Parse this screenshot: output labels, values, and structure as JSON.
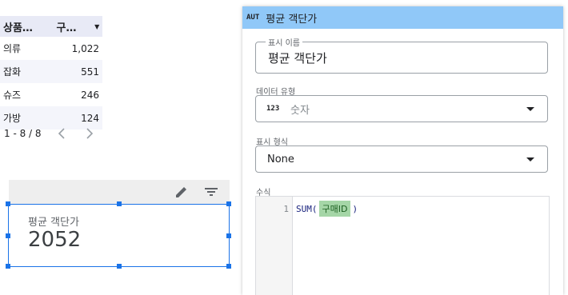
{
  "table": {
    "headers": {
      "name": "상품…",
      "value": "구…"
    },
    "rows": [
      {
        "name": "의류",
        "value": "1,022"
      },
      {
        "name": "잡화",
        "value": "551"
      },
      {
        "name": "슈즈",
        "value": "246"
      },
      {
        "name": "가방",
        "value": "124"
      }
    ],
    "pagination": "1 - 8 / 8"
  },
  "scorecard": {
    "label": "평균 객단가",
    "value": "2052"
  },
  "panel": {
    "type_badge": "AUT",
    "title": "평균 객단가",
    "name_field": {
      "label": "표시 이름",
      "value": "평균 객단가"
    },
    "data_type": {
      "label": "데이터 유형",
      "icon_text": "123",
      "value": "숫자"
    },
    "format": {
      "label": "표시 형식",
      "value": "None"
    },
    "formula": {
      "label": "수식",
      "line_number": "1",
      "function": "SUM(",
      "field_chip": "구매ID",
      "close": ")"
    }
  },
  "colors": {
    "accent": "#1a73e8",
    "panel_header": "#90c8f8",
    "chip": "#a5d6a7"
  }
}
